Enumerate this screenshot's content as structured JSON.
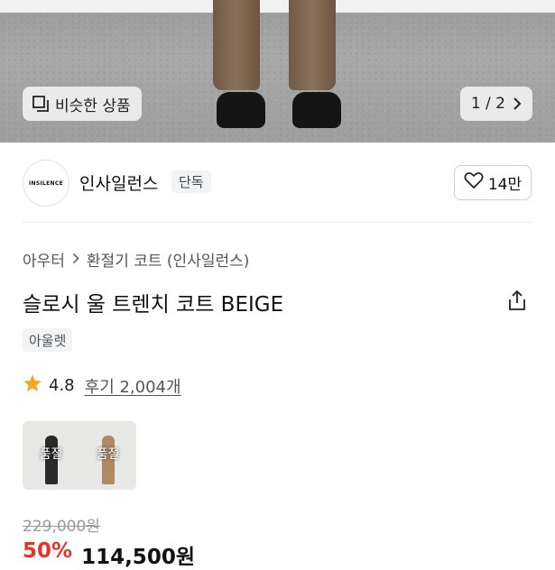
{
  "hero": {
    "similar_label": "비슷한 상품",
    "pager": "1 / 2"
  },
  "brand": {
    "logo_text": "INSILENCE",
    "name": "인사일런스",
    "badge": "단독",
    "like_count": "14만"
  },
  "breadcrumb": {
    "level1": "아우터",
    "level2": "환절기 코트 (인사일런스)"
  },
  "product": {
    "title": "슬로시 울 트렌치 코트 BEIGE",
    "tag": "아울렛",
    "rating": "4.8",
    "reviews": "후기 2,004개"
  },
  "styling": {
    "left_label": "품절",
    "right_label": "품절"
  },
  "price": {
    "original": "229,000원",
    "discount": "50%",
    "sale": "114,500원"
  },
  "colors": {
    "discount_red": "#e5332a",
    "star": "#f5a623"
  }
}
